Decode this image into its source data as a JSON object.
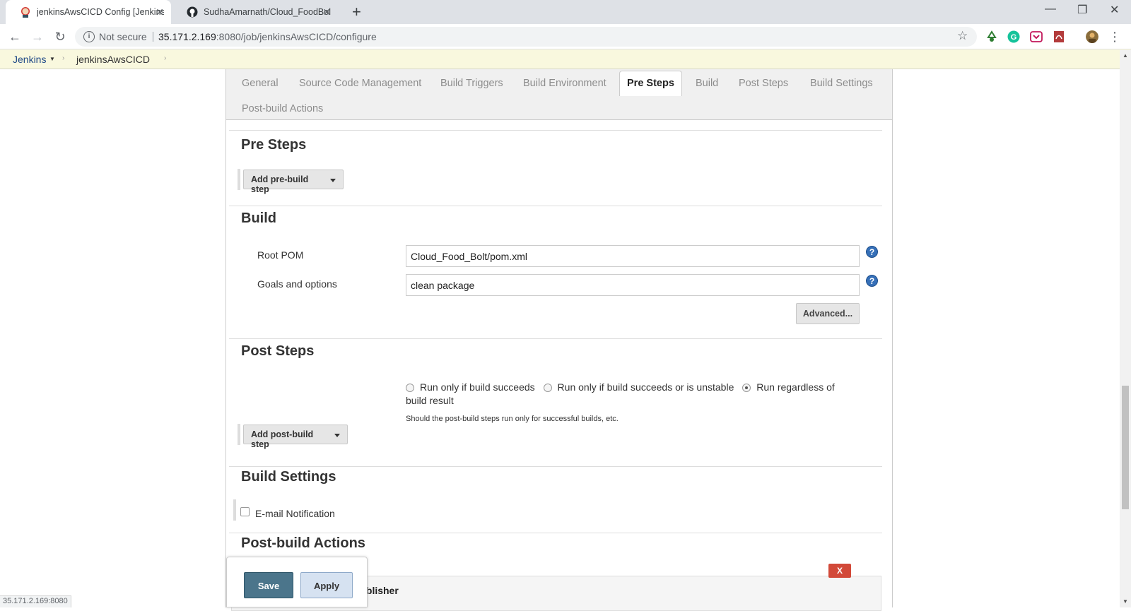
{
  "browser": {
    "tabs": [
      {
        "title": "jenkinsAwsCICD Config [Jenkins]",
        "active": true,
        "icon": "jenkins-icon"
      },
      {
        "title": "SudhaAmarnath/Cloud_FoodBolt",
        "active": false,
        "icon": "github-icon"
      }
    ],
    "new_tab": "+",
    "window_controls": {
      "minimize": "—",
      "restore": "❐",
      "close": "✕"
    },
    "security_label": "Not secure",
    "url_host": "35.171.2.169",
    "url_rest": ":8080/job/jenkinsAwsCICD/configure",
    "status_url": "35.171.2.169:8080"
  },
  "breadcrumb": {
    "root": "Jenkins",
    "job": "jenkinsAwsCICD"
  },
  "config_tabs": {
    "items": [
      "General",
      "Source Code Management",
      "Build Triggers",
      "Build Environment",
      "Pre Steps",
      "Build",
      "Post Steps",
      "Build Settings",
      "Post-build Actions"
    ],
    "active": "Pre Steps"
  },
  "pre_steps": {
    "title": "Pre Steps",
    "add_button": "Add pre-build step"
  },
  "build": {
    "title": "Build",
    "root_pom_label": "Root POM",
    "root_pom_value": "Cloud_Food_Bolt/pom.xml",
    "goals_label": "Goals and options",
    "goals_value": "clean package",
    "advanced_button": "Advanced..."
  },
  "post_steps": {
    "title": "Post Steps",
    "options": [
      "Run only if build succeeds",
      "Run only if build succeeds or is unstable",
      "Run regardless of build result"
    ],
    "selected_index": 2,
    "description": "Should the post-build steps run only for successful builds, etc.",
    "add_button": "Add post-build step"
  },
  "build_settings": {
    "title": "Build Settings",
    "email_label": "E-mail Notification",
    "email_checked": false
  },
  "post_build": {
    "title": "Post-build Actions",
    "publisher_title_visible": "Publisher",
    "delete_label": "X"
  },
  "actions": {
    "save": "Save",
    "apply": "Apply"
  },
  "colors": {
    "crumb_bg": "#f9f8de",
    "save_bg": "#4b758b",
    "apply_bg": "#d6e2f1",
    "delete_bg": "#d24939",
    "help_bg": "#3670b8"
  }
}
